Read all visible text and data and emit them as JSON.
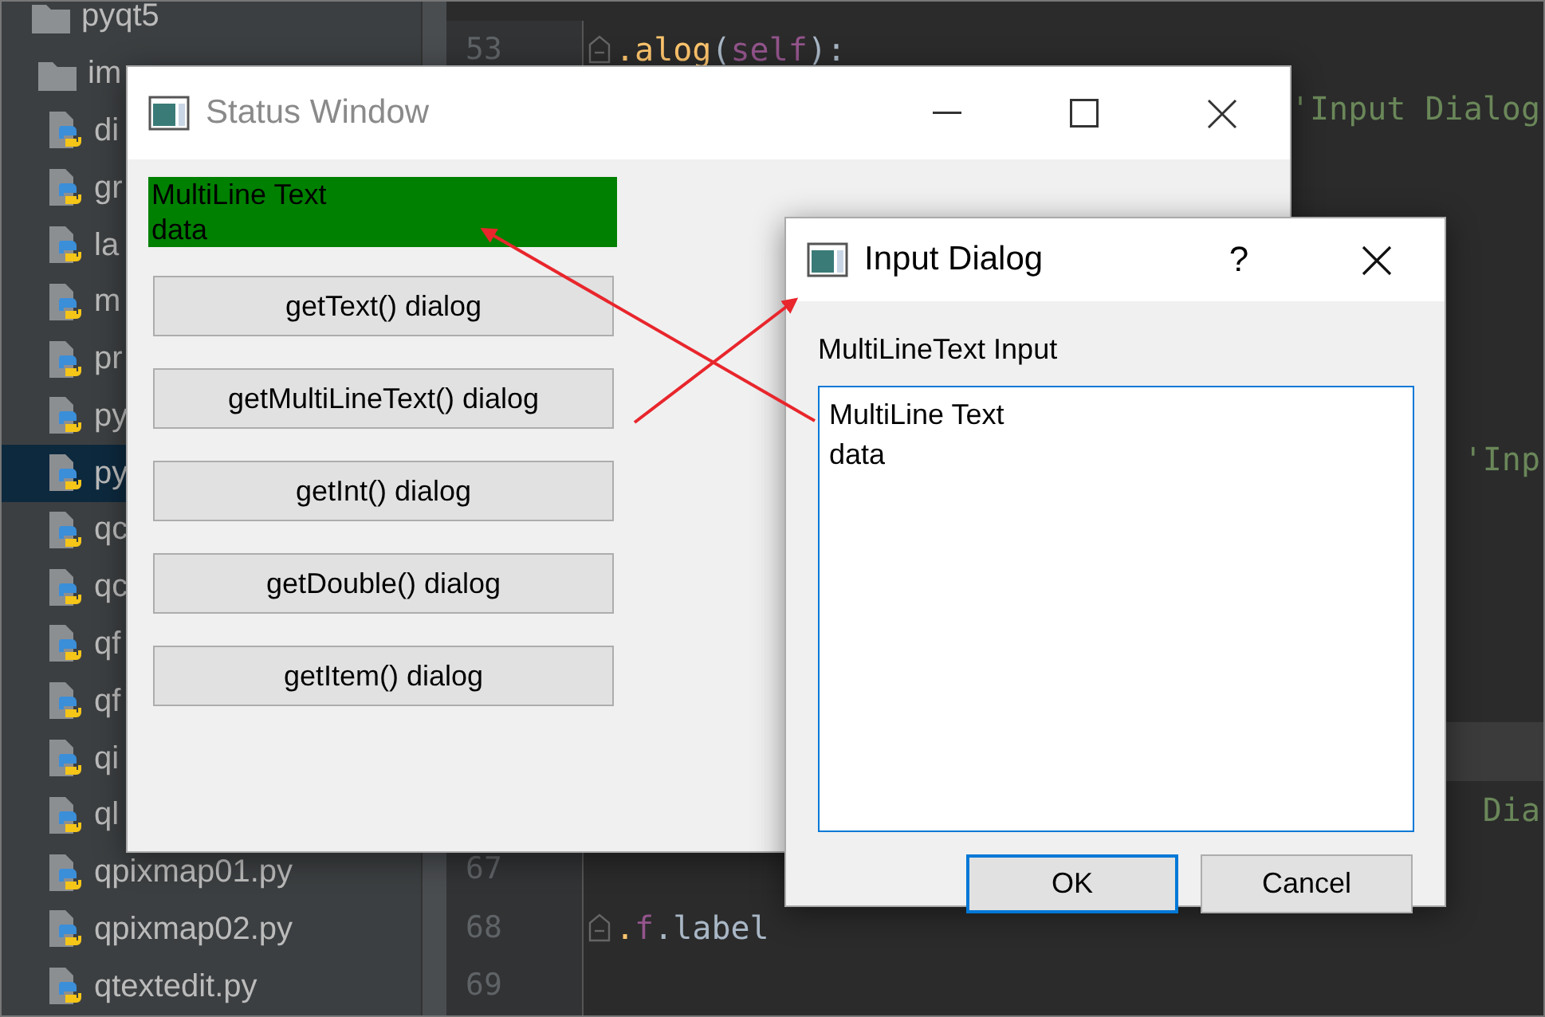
{
  "project_tree": {
    "items": [
      {
        "label": "pyqt5",
        "kind": "root",
        "selected": false
      },
      {
        "label": "im",
        "kind": "folder",
        "selected": false
      },
      {
        "label": "di",
        "kind": "py",
        "selected": false
      },
      {
        "label": "gr",
        "kind": "py",
        "selected": false
      },
      {
        "label": "la",
        "kind": "py",
        "selected": false
      },
      {
        "label": "m",
        "kind": "py",
        "selected": false
      },
      {
        "label": "pr",
        "kind": "py",
        "selected": false
      },
      {
        "label": "py",
        "kind": "py",
        "selected": false
      },
      {
        "label": "py",
        "kind": "py",
        "selected": true
      },
      {
        "label": "qc",
        "kind": "py",
        "selected": false
      },
      {
        "label": "qc",
        "kind": "py",
        "selected": false
      },
      {
        "label": "qf",
        "kind": "py",
        "selected": false
      },
      {
        "label": "qf",
        "kind": "py",
        "selected": false
      },
      {
        "label": "qi",
        "kind": "py",
        "selected": false
      },
      {
        "label": "ql",
        "kind": "py",
        "selected": false
      },
      {
        "label": "qpixmap01.py",
        "kind": "py",
        "selected": false
      },
      {
        "label": "qpixmap02.py",
        "kind": "py",
        "selected": false
      },
      {
        "label": "qtextedit.py",
        "kind": "py",
        "selected": false
      }
    ]
  },
  "editor": {
    "lines": [
      {
        "number": "53",
        "fold": true,
        "code": [
          {
            "text": ".alog",
            "kind": "fn"
          },
          {
            "text": "(",
            "kind": "plain"
          },
          {
            "text": "self",
            "kind": "self"
          },
          {
            "text": "):",
            "kind": "plain"
          }
        ]
      },
      {
        "tail": "'Input Dialog"
      },
      {
        "tail": "'Inp"
      },
      {
        "current": true
      },
      {
        "tail": "Dia"
      },
      {
        "number": "67"
      },
      {
        "number": "68",
        "fold": true,
        "code": [
          {
            "text": ".",
            "kind": "fn"
          },
          {
            "text": "f",
            "kind": "self"
          },
          {
            "text": ".label",
            "kind": "plain"
          }
        ]
      },
      {
        "number": "69"
      }
    ]
  },
  "status_window": {
    "title": "Status Window",
    "label": "MultiLine Text\ndata",
    "buttons": [
      "getText() dialog",
      "getMultiLineText() dialog",
      "getInt() dialog",
      "getDouble() dialog",
      "getItem() dialog"
    ]
  },
  "input_dialog": {
    "title": "Input Dialog",
    "help": "?",
    "prompt": "MultiLineText Input",
    "value": "MultiLine Text\ndata",
    "buttons": [
      {
        "label": "OK",
        "default": true
      },
      {
        "label": "Cancel",
        "default": false
      }
    ]
  }
}
